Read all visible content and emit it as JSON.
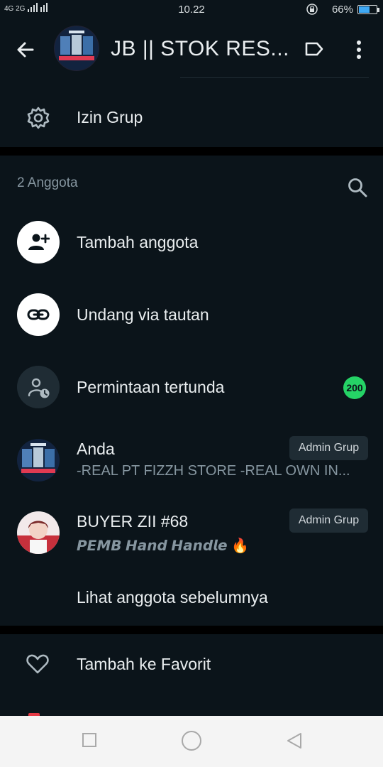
{
  "status_bar": {
    "signal": "4G 2G",
    "time": "10.22",
    "battery": "66%",
    "battery_level": 0.66
  },
  "header": {
    "title": "JB || STOK RES..."
  },
  "settings": {
    "group_permissions": "Izin Grup"
  },
  "members_section": {
    "count_label": "2 Anggota",
    "actions": [
      {
        "label": "Tambah anggota",
        "icon": "add-person-icon"
      },
      {
        "label": "Undang via tautan",
        "icon": "link-icon"
      },
      {
        "label": "Permintaan tertunda",
        "icon": "pending-person-icon",
        "badge": "200"
      }
    ],
    "members": [
      {
        "name": "Anda",
        "status": "-REAL PT FIZZH STORE -REAL OWN IN...",
        "role": "Admin Grup"
      },
      {
        "name": "BUYER ZII #68",
        "status": "𝙋𝙀𝙈𝘽 𝙃𝙖𝙣𝙙 𝙃𝙖𝙣𝙙𝙡𝙚 🔥",
        "role": "Admin Grup"
      }
    ],
    "see_previous": "Lihat anggota sebelumnya"
  },
  "favorites": {
    "label": "Tambah ke Favorit"
  },
  "colors": {
    "background": "#0b141a",
    "accent_green": "#25d366",
    "secondary_text": "#8696a0"
  }
}
